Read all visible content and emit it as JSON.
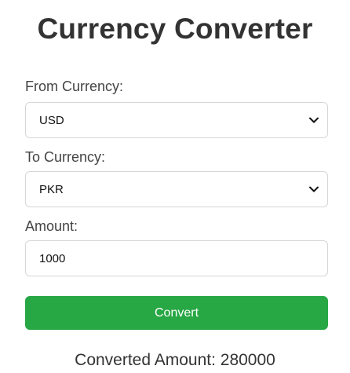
{
  "app": {
    "title": "Currency Converter"
  },
  "form": {
    "from_label": "From Currency:",
    "from_value": "USD",
    "to_label": "To Currency:",
    "to_value": "PKR",
    "amount_label": "Amount:",
    "amount_value": "1000",
    "convert_label": "Convert"
  },
  "result": {
    "text": "Converted Amount: 280000"
  },
  "colors": {
    "button": "#28a745",
    "button_text": "#ffffff",
    "border": "#d6d6d6"
  },
  "icons": {
    "dropdown": "chevron-down-icon"
  }
}
